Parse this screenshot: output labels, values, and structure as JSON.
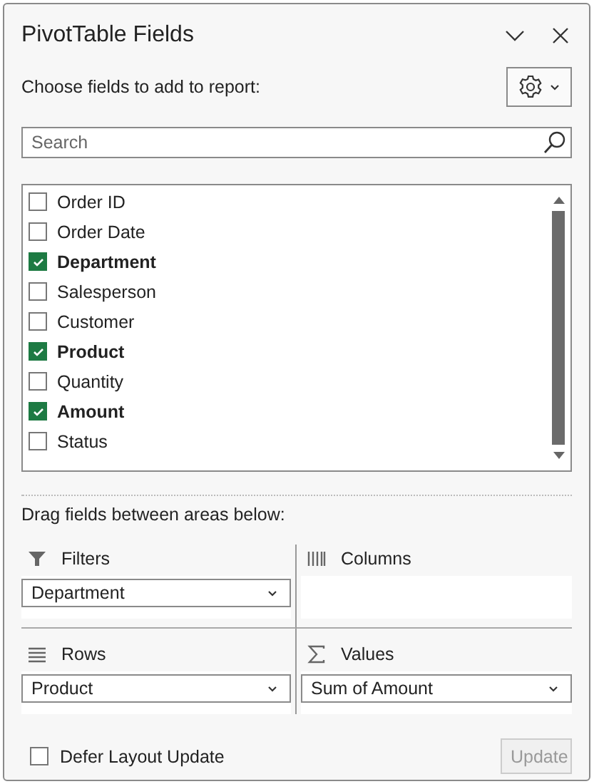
{
  "panel": {
    "title": "PivotTable Fields",
    "subtitle": "Choose fields to add to report:"
  },
  "search": {
    "placeholder": "Search"
  },
  "fields": [
    {
      "name": "Order ID",
      "checked": false
    },
    {
      "name": "Order Date",
      "checked": false
    },
    {
      "name": "Department",
      "checked": true
    },
    {
      "name": "Salesperson",
      "checked": false
    },
    {
      "name": "Customer",
      "checked": false
    },
    {
      "name": "Product",
      "checked": true
    },
    {
      "name": "Quantity",
      "checked": false
    },
    {
      "name": "Amount",
      "checked": true
    },
    {
      "name": "Status",
      "checked": false
    }
  ],
  "areas_heading": "Drag fields between areas below:",
  "areas": [
    {
      "kind": "filters",
      "label": "Filters",
      "items": [
        "Department"
      ]
    },
    {
      "kind": "columns",
      "label": "Columns"
    },
    {
      "kind": "rows",
      "label": "Rows",
      "items": [
        "Product"
      ]
    },
    {
      "kind": "values",
      "label": "Values",
      "items": [
        "Sum of Amount"
      ]
    }
  ],
  "defer": {
    "label": "Defer Layout Update",
    "checked": false
  },
  "update_button": {
    "label": "Update",
    "disabled": true
  }
}
